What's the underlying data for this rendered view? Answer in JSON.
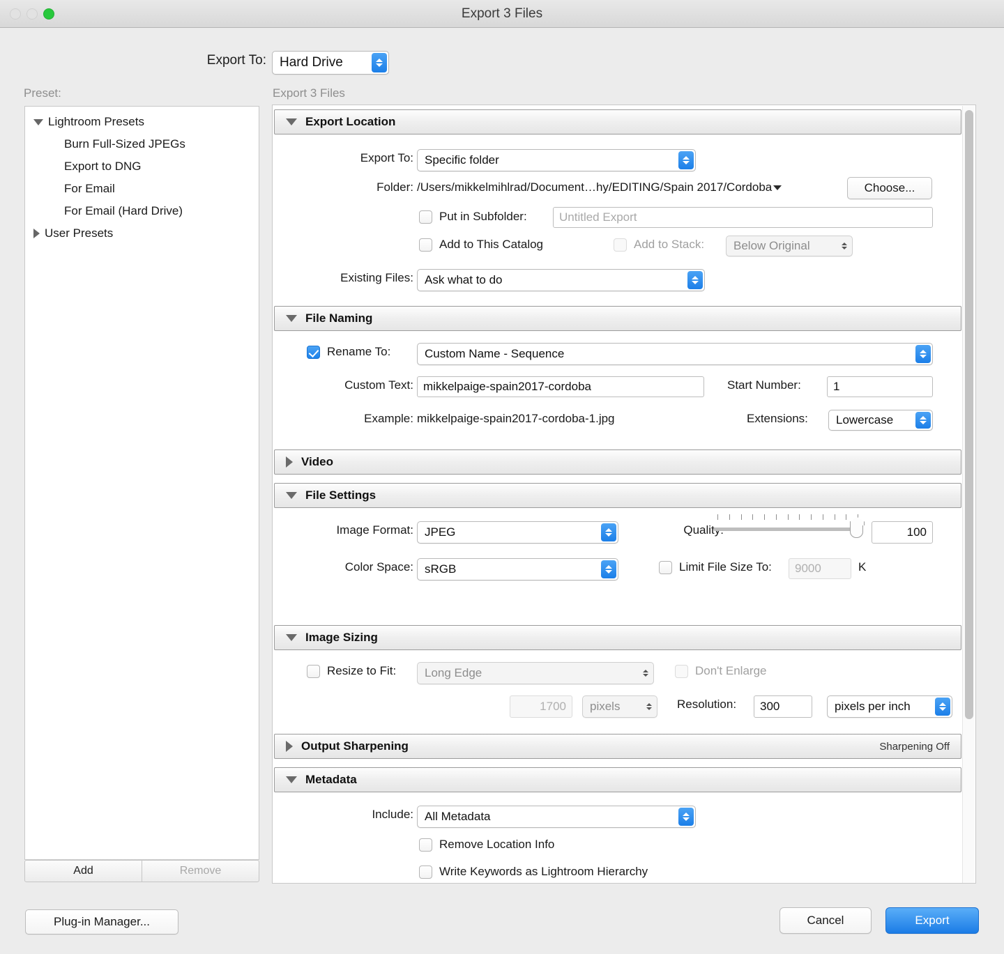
{
  "window": {
    "title": "Export 3 Files",
    "traffic_lights": [
      "close-disabled",
      "minimize-disabled",
      "zoom-green"
    ]
  },
  "top": {
    "export_to_label": "Export To:",
    "export_to_value": "Hard Drive"
  },
  "preset": {
    "label": "Preset:",
    "items": [
      {
        "label": "Lightroom Presets",
        "type": "group",
        "expanded": true
      },
      {
        "label": "Burn Full-Sized JPEGs",
        "type": "child"
      },
      {
        "label": "Export to DNG",
        "type": "child"
      },
      {
        "label": "For Email",
        "type": "child"
      },
      {
        "label": "For Email (Hard Drive)",
        "type": "child"
      },
      {
        "label": "User Presets",
        "type": "group",
        "expanded": false
      }
    ],
    "add_label": "Add",
    "remove_label": "Remove"
  },
  "panel": {
    "caption": "Export 3 Files"
  },
  "export_location": {
    "title": "Export Location",
    "export_to_label": "Export To:",
    "export_to_value": "Specific folder",
    "folder_label": "Folder:",
    "folder_value": "/Users/mikkelmihlrad/Document…hy/EDITING/Spain 2017/Cordoba",
    "choose_label": "Choose...",
    "put_in_subfolder_label": "Put in Subfolder:",
    "put_in_subfolder_checked": false,
    "subfolder_placeholder": "Untitled Export",
    "add_to_catalog_label": "Add to This Catalog",
    "add_to_catalog_checked": false,
    "add_to_stack_label": "Add to Stack:",
    "add_to_stack_checked": false,
    "add_to_stack_value": "Below Original",
    "existing_files_label": "Existing Files:",
    "existing_files_value": "Ask what to do"
  },
  "file_naming": {
    "title": "File Naming",
    "rename_to_label": "Rename To:",
    "rename_to_checked": true,
    "rename_to_value": "Custom Name - Sequence",
    "custom_text_label": "Custom Text:",
    "custom_text_value": "mikkelpaige-spain2017-cordoba",
    "start_number_label": "Start Number:",
    "start_number_value": "1",
    "example_label": "Example:",
    "example_value": "mikkelpaige-spain2017-cordoba-1.jpg",
    "extensions_label": "Extensions:",
    "extensions_value": "Lowercase"
  },
  "video": {
    "title": "Video",
    "expanded": false
  },
  "file_settings": {
    "title": "File Settings",
    "image_format_label": "Image Format:",
    "image_format_value": "JPEG",
    "quality_label": "Quality:",
    "quality_value": "100",
    "quality_percent": 100,
    "quality_ticks": 13,
    "color_space_label": "Color Space:",
    "color_space_value": "sRGB",
    "limit_file_size_label": "Limit File Size To:",
    "limit_file_size_checked": false,
    "limit_file_size_value": "9000",
    "limit_file_size_unit": "K"
  },
  "image_sizing": {
    "title": "Image Sizing",
    "resize_to_fit_label": "Resize to Fit:",
    "resize_to_fit_checked": false,
    "resize_to_fit_value": "Long Edge",
    "dont_enlarge_label": "Don't Enlarge",
    "dont_enlarge_checked": false,
    "size_value": "1700",
    "size_unit": "pixels",
    "resolution_label": "Resolution:",
    "resolution_value": "300",
    "resolution_unit": "pixels per inch"
  },
  "output_sharpening": {
    "title": "Output Sharpening",
    "status": "Sharpening Off",
    "expanded": false
  },
  "metadata": {
    "title": "Metadata",
    "include_label": "Include:",
    "include_value": "All Metadata",
    "remove_location_label": "Remove Location Info",
    "remove_location_checked": false,
    "write_keywords_label": "Write Keywords as Lightroom Hierarchy",
    "write_keywords_checked": false
  },
  "footer": {
    "plugin_manager_label": "Plug-in Manager...",
    "cancel_label": "Cancel",
    "export_label": "Export"
  },
  "colors": {
    "accent": "#2f8ced",
    "window_bg": "#ececec",
    "panel_bg": "#ffffff"
  }
}
